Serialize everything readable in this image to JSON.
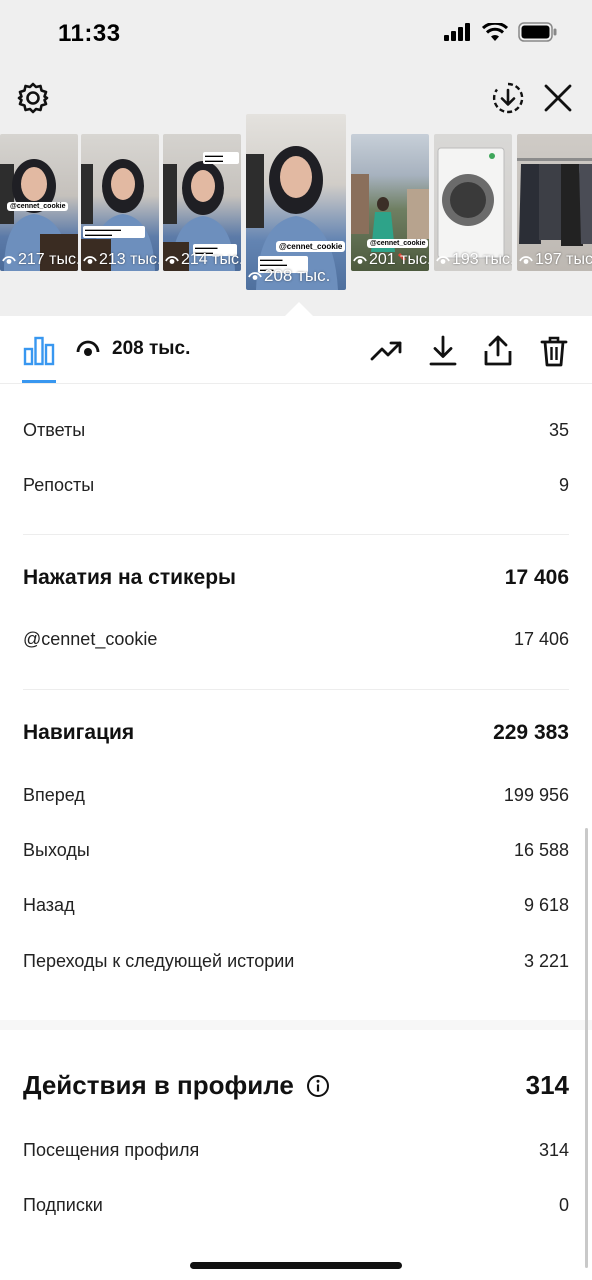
{
  "status_bar": {
    "time": "11:33"
  },
  "stories": [
    {
      "views": "217 тыс.",
      "sticker": "@cennet_cookie"
    },
    {
      "views": "213 тыс.",
      "sticker": ""
    },
    {
      "views": "214 тыс.",
      "sticker": ""
    },
    {
      "views": "208 тыс.",
      "sticker": "@cennet_cookie",
      "selected": true
    },
    {
      "views": "201 тыс.",
      "sticker": "@cennet_cookie"
    },
    {
      "views": "193 тыс.",
      "sticker": ""
    },
    {
      "views": "197 тыс.",
      "sticker": ""
    }
  ],
  "toolbar": {
    "views": "208 тыс."
  },
  "interactions": [
    {
      "label": "Ответы",
      "value": "35"
    },
    {
      "label": "Репосты",
      "value": "9"
    }
  ],
  "sticker_taps": {
    "title": "Нажатия на стикеры",
    "total": "17 406",
    "items": [
      {
        "label": "@cennet_cookie",
        "value": "17 406"
      }
    ]
  },
  "navigation": {
    "title": "Навигация",
    "total": "229 383",
    "items": [
      {
        "label": "Вперед",
        "value": "199 956"
      },
      {
        "label": "Выходы",
        "value": "16 588"
      },
      {
        "label": "Назад",
        "value": "9 618"
      },
      {
        "label": "Переходы к следующей истории",
        "value": "3 221"
      }
    ]
  },
  "profile_actions": {
    "title": "Действия в профиле",
    "total": "314",
    "items": [
      {
        "label": "Посещения профиля",
        "value": "314"
      },
      {
        "label": "Подписки",
        "value": "0"
      }
    ]
  },
  "colors": {
    "accent": "#3897f0",
    "divider": "#ededed",
    "header_bg": "#efefef"
  },
  "icons": [
    "gear-icon",
    "download-circle-icon",
    "close-icon",
    "bar-chart-icon",
    "eye-icon",
    "trending-icon",
    "download-icon",
    "share-icon",
    "trash-icon",
    "info-icon"
  ]
}
